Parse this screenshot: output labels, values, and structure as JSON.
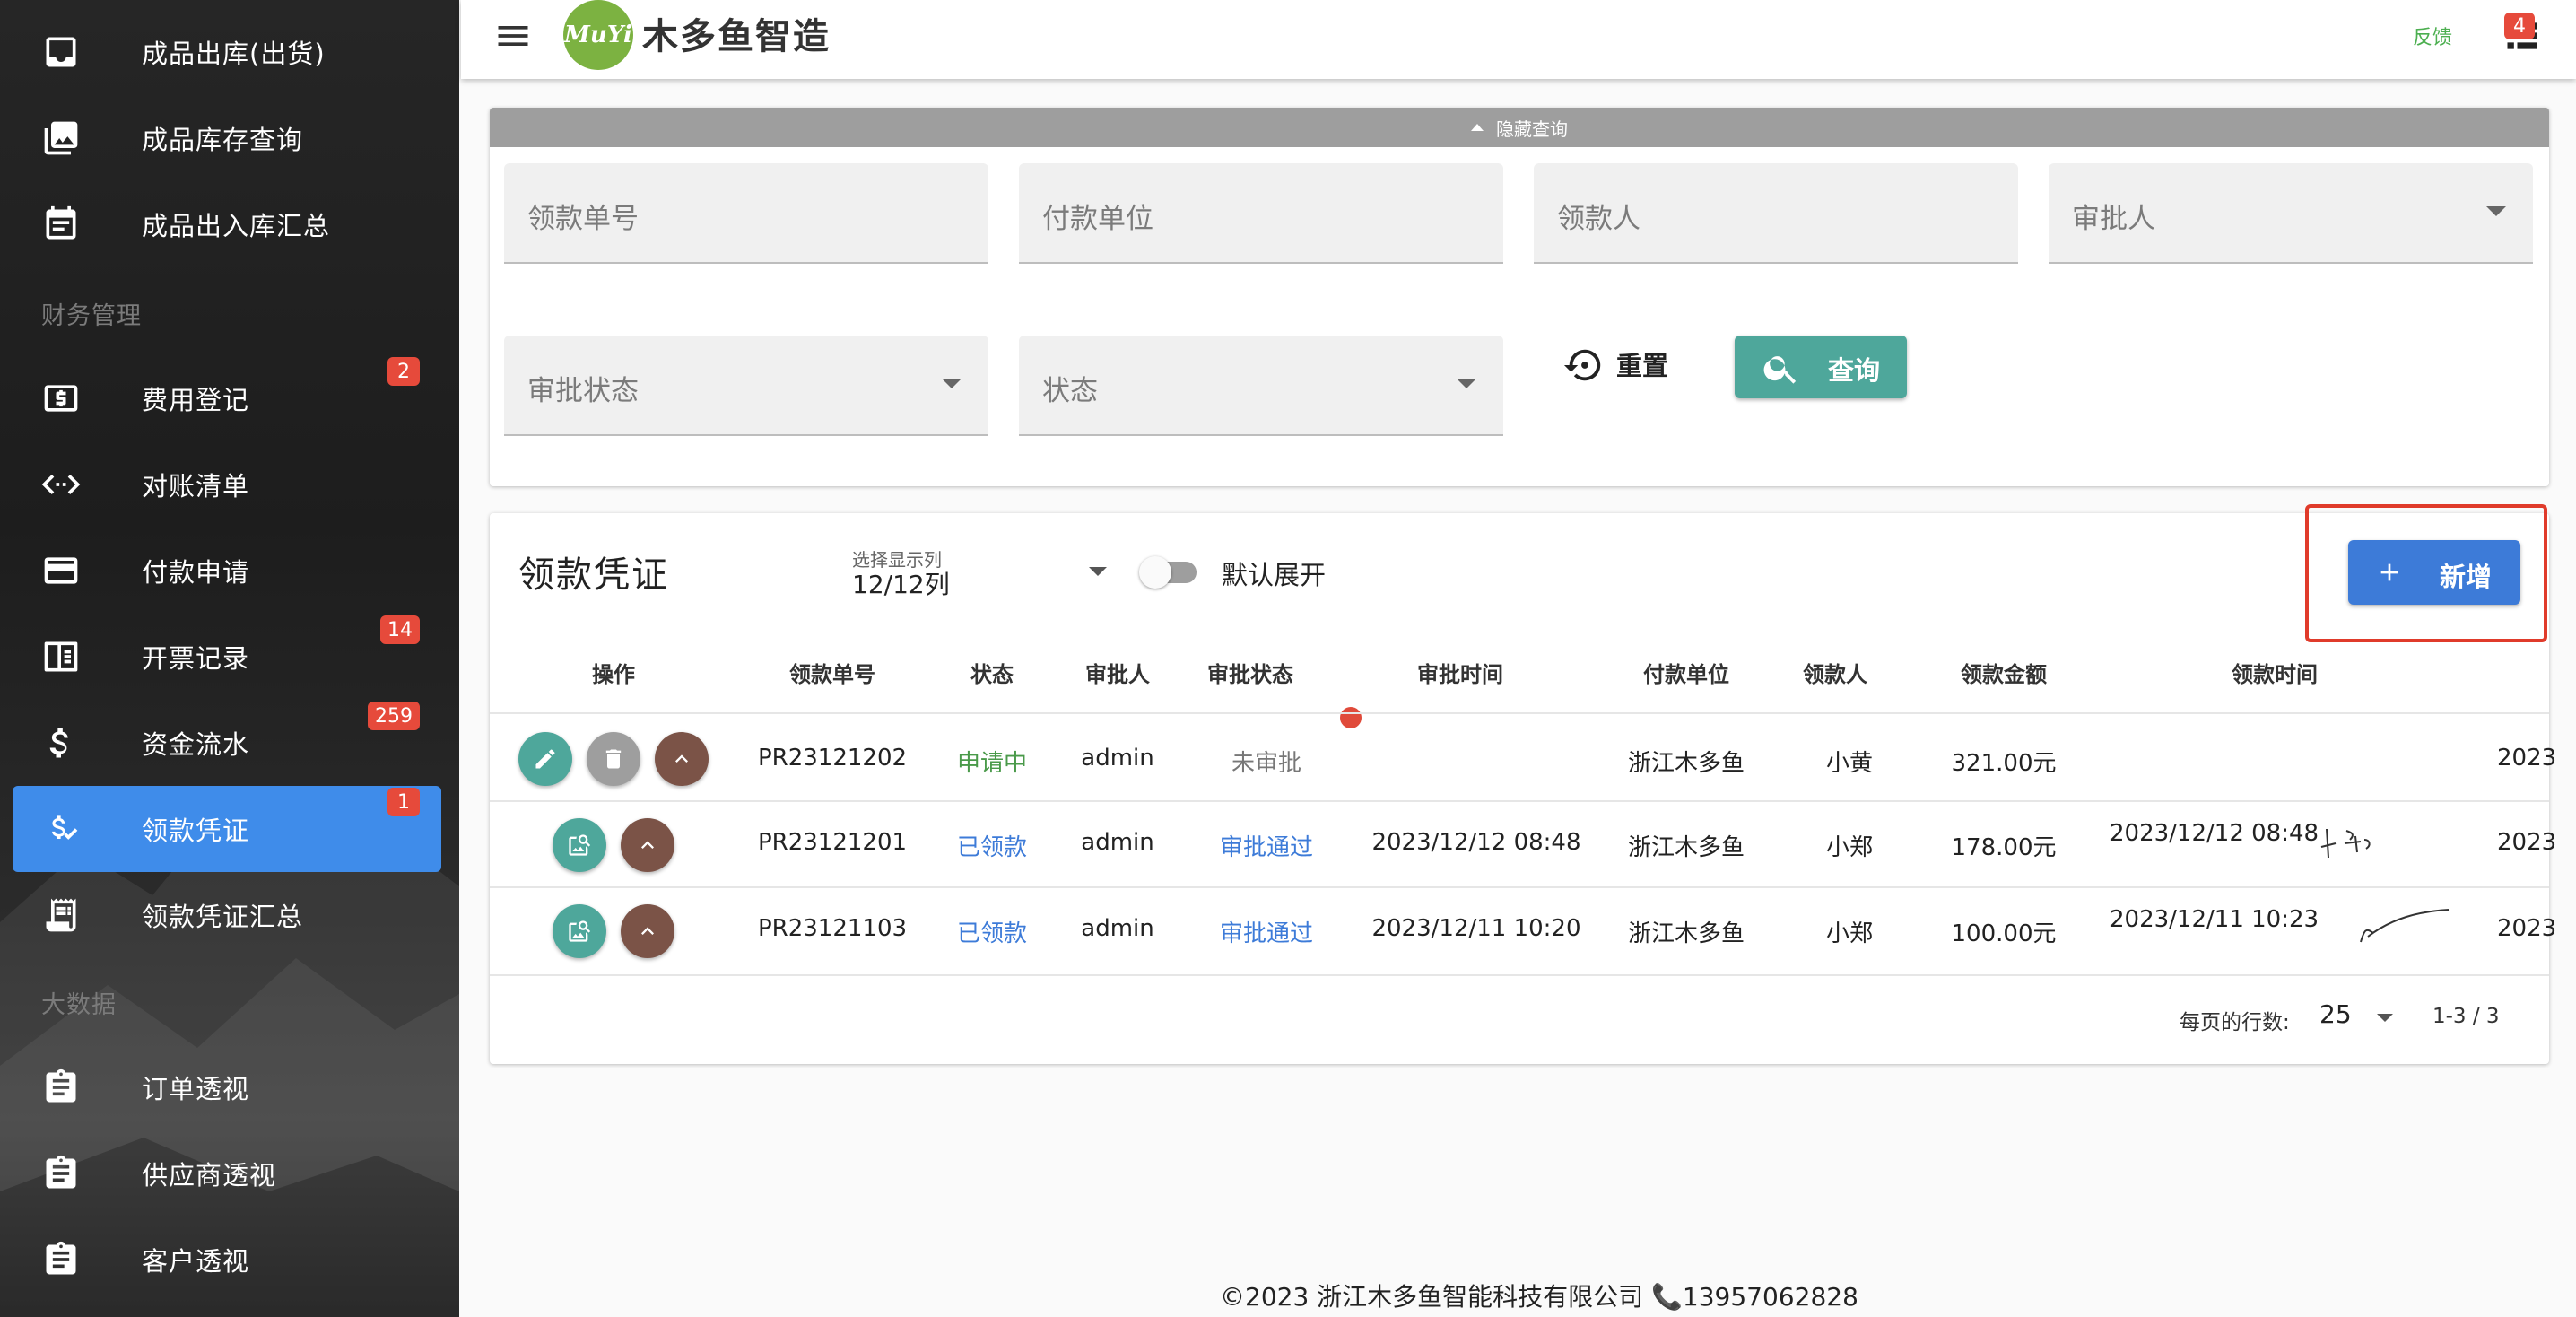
{
  "sidebar": {
    "items": [
      {
        "label": "成品出库(出货)",
        "icon": "inbox-icon"
      },
      {
        "label": "成品库存查询",
        "icon": "photo-library-icon"
      },
      {
        "label": "成品出入库汇总",
        "icon": "calendar-icon"
      },
      {
        "label": "费用登记",
        "icon": "dollar-box-icon",
        "badge": "2"
      },
      {
        "label": "对账清单",
        "icon": "code-arrows-icon"
      },
      {
        "label": "付款申请",
        "icon": "credit-card-icon"
      },
      {
        "label": "开票记录",
        "icon": "receipt-icon",
        "badge": "14"
      },
      {
        "label": "资金流水",
        "icon": "dollar-icon",
        "badge": "259"
      },
      {
        "label": "领款凭证",
        "icon": "dollar-check-icon",
        "badge": "1",
        "active": true
      },
      {
        "label": "领款凭证汇总",
        "icon": "receipt-long-icon"
      },
      {
        "label": "订单透视",
        "icon": "clipboard-icon"
      },
      {
        "label": "供应商透视",
        "icon": "clipboard-icon"
      },
      {
        "label": "客户透视",
        "icon": "clipboard-icon"
      }
    ],
    "sections": {
      "finance": "财务管理",
      "bigdata": "大数据"
    }
  },
  "header": {
    "logo_text": "MuYi",
    "title": "木多鱼智造",
    "feedback": "反馈",
    "notification_count": "4"
  },
  "query": {
    "toggle_label": "隐藏查询",
    "fields": {
      "voucher_no": "领款单号",
      "payer": "付款单位",
      "payee": "领款人",
      "approver": "审批人",
      "approval_status": "审批状态",
      "status": "状态"
    },
    "reset_label": "重置",
    "search_label": "查询"
  },
  "table_card": {
    "title": "领款凭证",
    "column_select_label": "选择显示列",
    "column_select_value": "12/12列",
    "expand_label": "默认展开",
    "add_label": "新增",
    "headers": {
      "actions": "操作",
      "voucher_no": "领款单号",
      "status": "状态",
      "approver": "审批人",
      "approval_status": "审批状态",
      "approval_time": "审批时间",
      "payer": "付款单位",
      "payee": "领款人",
      "amount": "领款金额",
      "claim_time": "领款时间"
    },
    "rows": [
      {
        "voucher_no": "PR23121202",
        "status": "申请中",
        "approver": "admin",
        "approval_status": "未审批",
        "approval_time": "",
        "payer": "浙江木多鱼",
        "payee": "小黄",
        "amount": "321.00元",
        "claim_time": "",
        "extra": "2023"
      },
      {
        "voucher_no": "PR23121201",
        "status": "已领款",
        "approver": "admin",
        "approval_status": "审批通过",
        "approval_time": "2023/12/12 08:48",
        "payer": "浙江木多鱼",
        "payee": "小郑",
        "amount": "178.00元",
        "claim_time": "2023/12/12 08:48",
        "extra": "2023"
      },
      {
        "voucher_no": "PR23121103",
        "status": "已领款",
        "approver": "admin",
        "approval_status": "审批通过",
        "approval_time": "2023/12/11 10:20",
        "payer": "浙江木多鱼",
        "payee": "小郑",
        "amount": "100.00元",
        "claim_time": "2023/12/11 10:23",
        "extra": "2023"
      }
    ],
    "pager": {
      "rows_per_page_label": "每页的行数:",
      "rows_per_page": "25",
      "range": "1-3 / 3"
    }
  },
  "footer": {
    "text": "©2023 浙江木多鱼智能科技有限公司 📞13957062828"
  },
  "colors": {
    "active_nav": "#3f8cea",
    "teal": "#4ea79b",
    "primary": "#3d7bd8",
    "badge": "#e64a3b",
    "highlight": "#e03b2b"
  }
}
